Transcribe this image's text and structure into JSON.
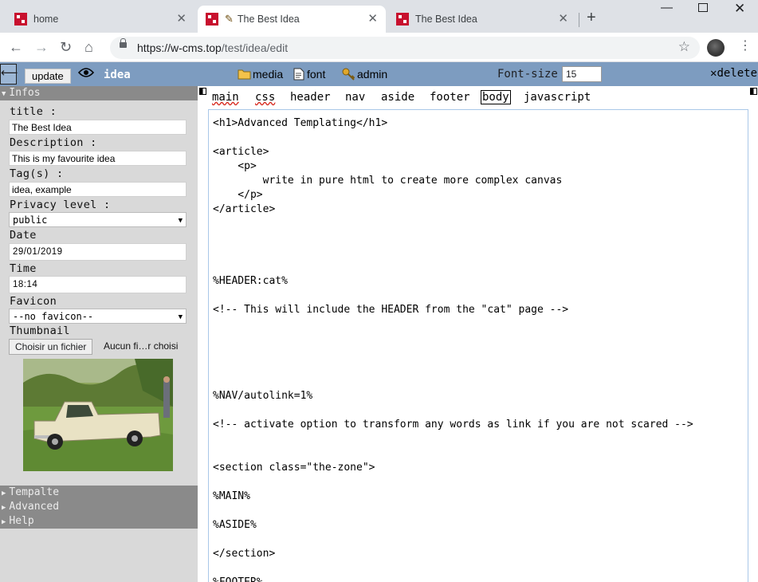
{
  "browser": {
    "tabs": [
      {
        "title": "home",
        "active": false
      },
      {
        "title": "The Best Idea",
        "active": true
      },
      {
        "title": "The Best Idea",
        "active": false
      }
    ],
    "url_host": "https://w-cms.top",
    "url_path": "/test/idea/edit"
  },
  "cmsbar": {
    "update_label": "update",
    "idea_name": "idea",
    "media_label": "media",
    "font_label": "font",
    "admin_label": "admin",
    "font_size_label": "Font-size",
    "font_size_value": "15",
    "delete_label": "delete"
  },
  "sidebar": {
    "infos_label": "Infos",
    "title_label": "title :",
    "title_value": "The Best Idea",
    "description_label": "Description :",
    "description_value": "This is my favourite idea",
    "tags_label": "Tag(s) :",
    "tags_value": "idea, example",
    "privacy_label": "Privacy level :",
    "privacy_value": "public",
    "date_label": "Date",
    "date_value": "29/01/2019",
    "time_label": "Time",
    "time_value": "18:14",
    "favicon_label": "Favicon",
    "favicon_value": "--no favicon--",
    "thumbnail_label": "Thumbnail",
    "file_button": "Choisir un fichier",
    "file_text": "Aucun fi…r choisi",
    "template_label": "Tempalte",
    "advanced_label": "Advanced",
    "help_label": "Help"
  },
  "editor": {
    "tabs": [
      "main",
      "css",
      "header",
      "nav",
      "aside",
      "footer",
      "body",
      "javascript"
    ],
    "active_tab": "body",
    "content": "<h1>Advanced Templating</h1>\n\n<article>\n    <p>\n        write in pure html to create more complex canvas\n    </p>\n</article>\n\n\n\n\n%HEADER:cat%\n\n<!-- This will include the HEADER from the \"cat\" page -->\n\n\n\n\n\n%NAV/autolink=1%\n\n<!-- activate option to transform any words as link if you are not scared -->\n\n\n<section class=\"the-zone\">\n\n%MAIN%\n\n%ASIDE%\n\n</section>\n\n%FOOTER%"
  }
}
